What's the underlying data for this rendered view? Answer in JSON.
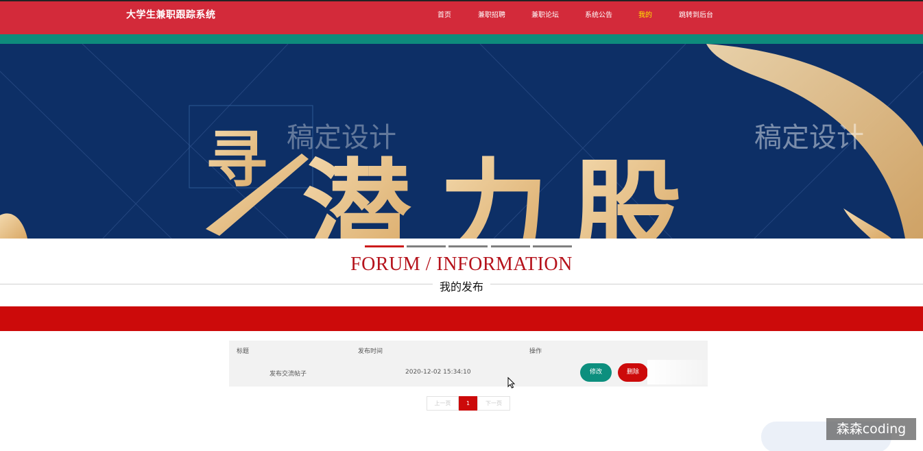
{
  "header": {
    "brand": "大学生兼职跟踪系统",
    "nav": [
      {
        "label": "首页",
        "active": false
      },
      {
        "label": "兼职招聘",
        "active": false
      },
      {
        "label": "兼职论坛",
        "active": false
      },
      {
        "label": "系统公告",
        "active": false
      },
      {
        "label": "我的",
        "active": true
      },
      {
        "label": "跳转到后台",
        "active": false
      }
    ],
    "colors": {
      "header_bg": "#d32a3a",
      "teal_bar": "#0e8b7c",
      "active_nav": "#ffe600"
    }
  },
  "banner": {
    "calligraphy": [
      "寻",
      "潜",
      "力",
      "股"
    ],
    "watermark_text": "稿定设计",
    "colors": {
      "bg": "#0d2f66",
      "gold": "#e8c48e"
    }
  },
  "carousel": {
    "count": 5,
    "active_index": 0
  },
  "section": {
    "title": "FORUM / INFORMATION",
    "subtitle": "我的发布"
  },
  "table": {
    "headers": [
      "标题",
      "发布时间",
      "操作"
    ],
    "rows": [
      {
        "title": "发布交流帖子",
        "time": "2020-12-02 15:34:10",
        "edit_label": "修改",
        "delete_label": "删除"
      }
    ]
  },
  "pagination": {
    "prev": "上一页",
    "current": "1",
    "next": "下一页"
  },
  "watermark": {
    "text": "森森coding"
  }
}
